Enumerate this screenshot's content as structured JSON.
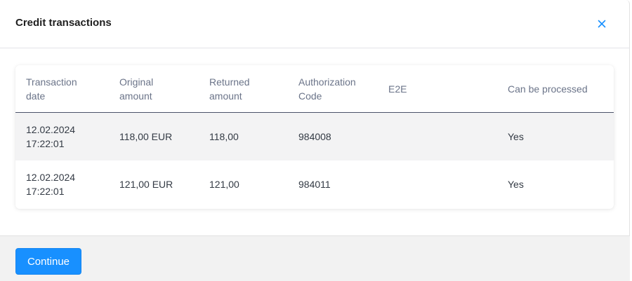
{
  "modal": {
    "title": "Credit transactions",
    "close_icon": "close-icon",
    "accent_color": "#1890ff"
  },
  "table": {
    "headers": {
      "transaction_date": "Transaction\ndate",
      "original_amount": "Original\namount",
      "returned_amount": "Returned\namount",
      "authorization_code": "Authorization\nCode",
      "e2e": "E2E",
      "can_be_processed": "Can be processed"
    },
    "rows": [
      {
        "transaction_date": "12.02.2024\n17:22:01",
        "original_amount": "118,00 EUR",
        "returned_amount": "118,00",
        "authorization_code": "984008",
        "e2e": "",
        "can_be_processed": "Yes"
      },
      {
        "transaction_date": "12.02.2024\n17:22:01",
        "original_amount": "121,00 EUR",
        "returned_amount": "121,00",
        "authorization_code": "984011",
        "e2e": "",
        "can_be_processed": "Yes"
      }
    ]
  },
  "footer": {
    "continue_label": "Continue"
  }
}
